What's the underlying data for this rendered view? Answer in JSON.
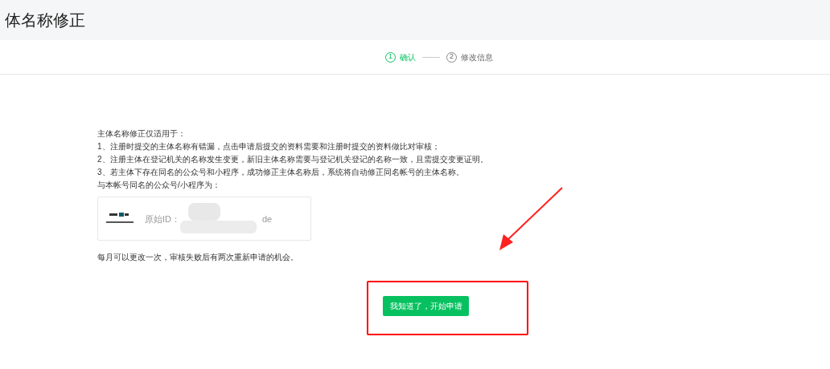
{
  "header": {
    "title": "体名称修正"
  },
  "steps": [
    {
      "number": "1",
      "label": "确认",
      "selected": true
    },
    {
      "number": "2",
      "label": "修改信息",
      "selected": false
    }
  ],
  "notice": {
    "intro": "主体名称修正仅适用于：",
    "items": [
      "1、注册时提交的主体名称有错漏，点击申请后提交的资料需要和注册时提交的资料做比对审核；",
      "2、注册主体在登记机关的名称发生变更，新旧主体名称需要与登记机关登记的名称一致，且需提交变更证明。",
      "3、若主体下存在同名的公众号和小程序，成功修正主体名称后，系统将自动修正同名帐号的主体名称。"
    ],
    "same_name_label": "与本帐号同名的公众号/小程序为：",
    "account": {
      "id_label": "原始ID：",
      "id_end": "de"
    },
    "footnote": "每月可以更改一次，审核失败后有两次重新申请的机会。"
  },
  "start_button": "我知道了，开始申请"
}
